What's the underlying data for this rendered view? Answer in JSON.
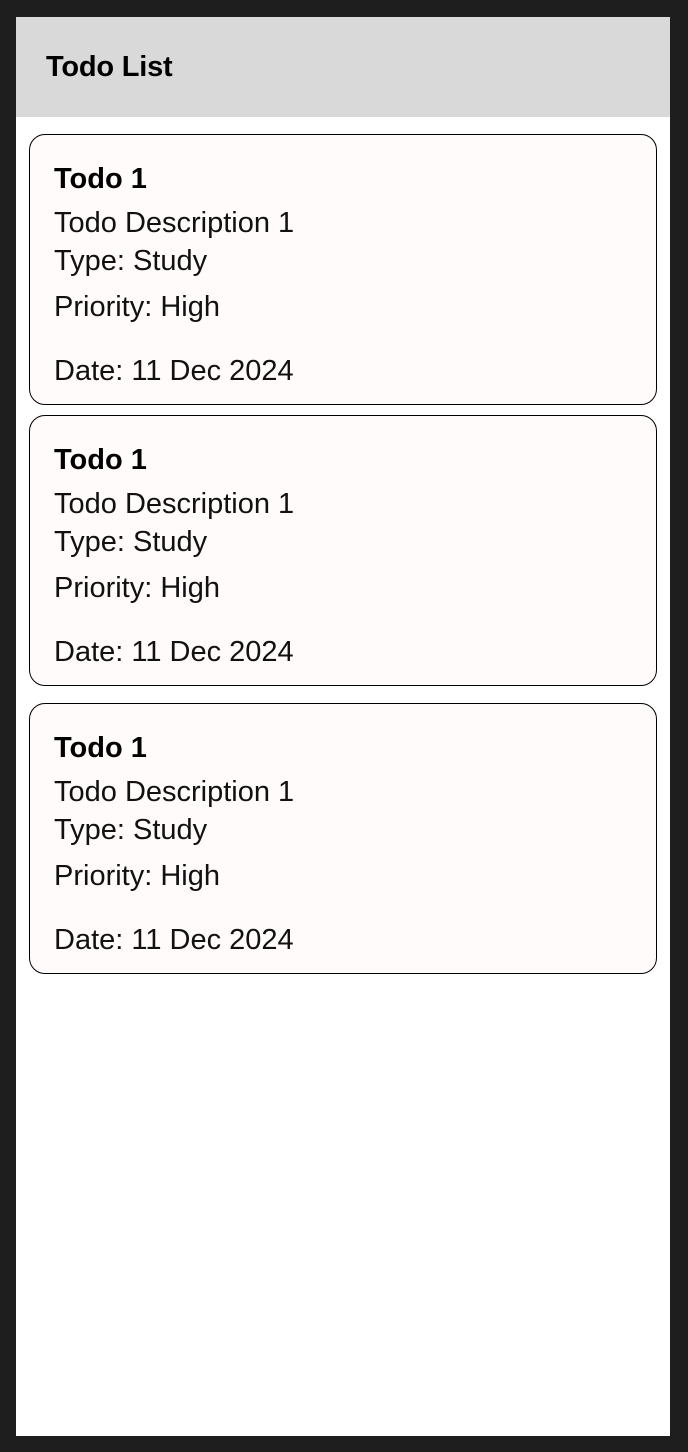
{
  "header": {
    "title": "Todo List"
  },
  "todos": [
    {
      "title": "Todo 1",
      "description": "Todo Description 1",
      "type": "Type: Study",
      "priority": "Priority: High",
      "date": "Date: 11 Dec 2024"
    },
    {
      "title": "Todo 1",
      "description": "Todo Description 1",
      "type": "Type: Study",
      "priority": "Priority: High",
      "date": "Date: 11 Dec 2024"
    },
    {
      "title": "Todo 1",
      "description": "Todo Description 1",
      "type": "Type: Study",
      "priority": "Priority: High",
      "date": "Date: 11 Dec 2024"
    }
  ],
  "colors": {
    "header_bg": "#d9d9d9",
    "card_bg": "#fffbfa",
    "frame_bg": "#1e1e1e"
  }
}
